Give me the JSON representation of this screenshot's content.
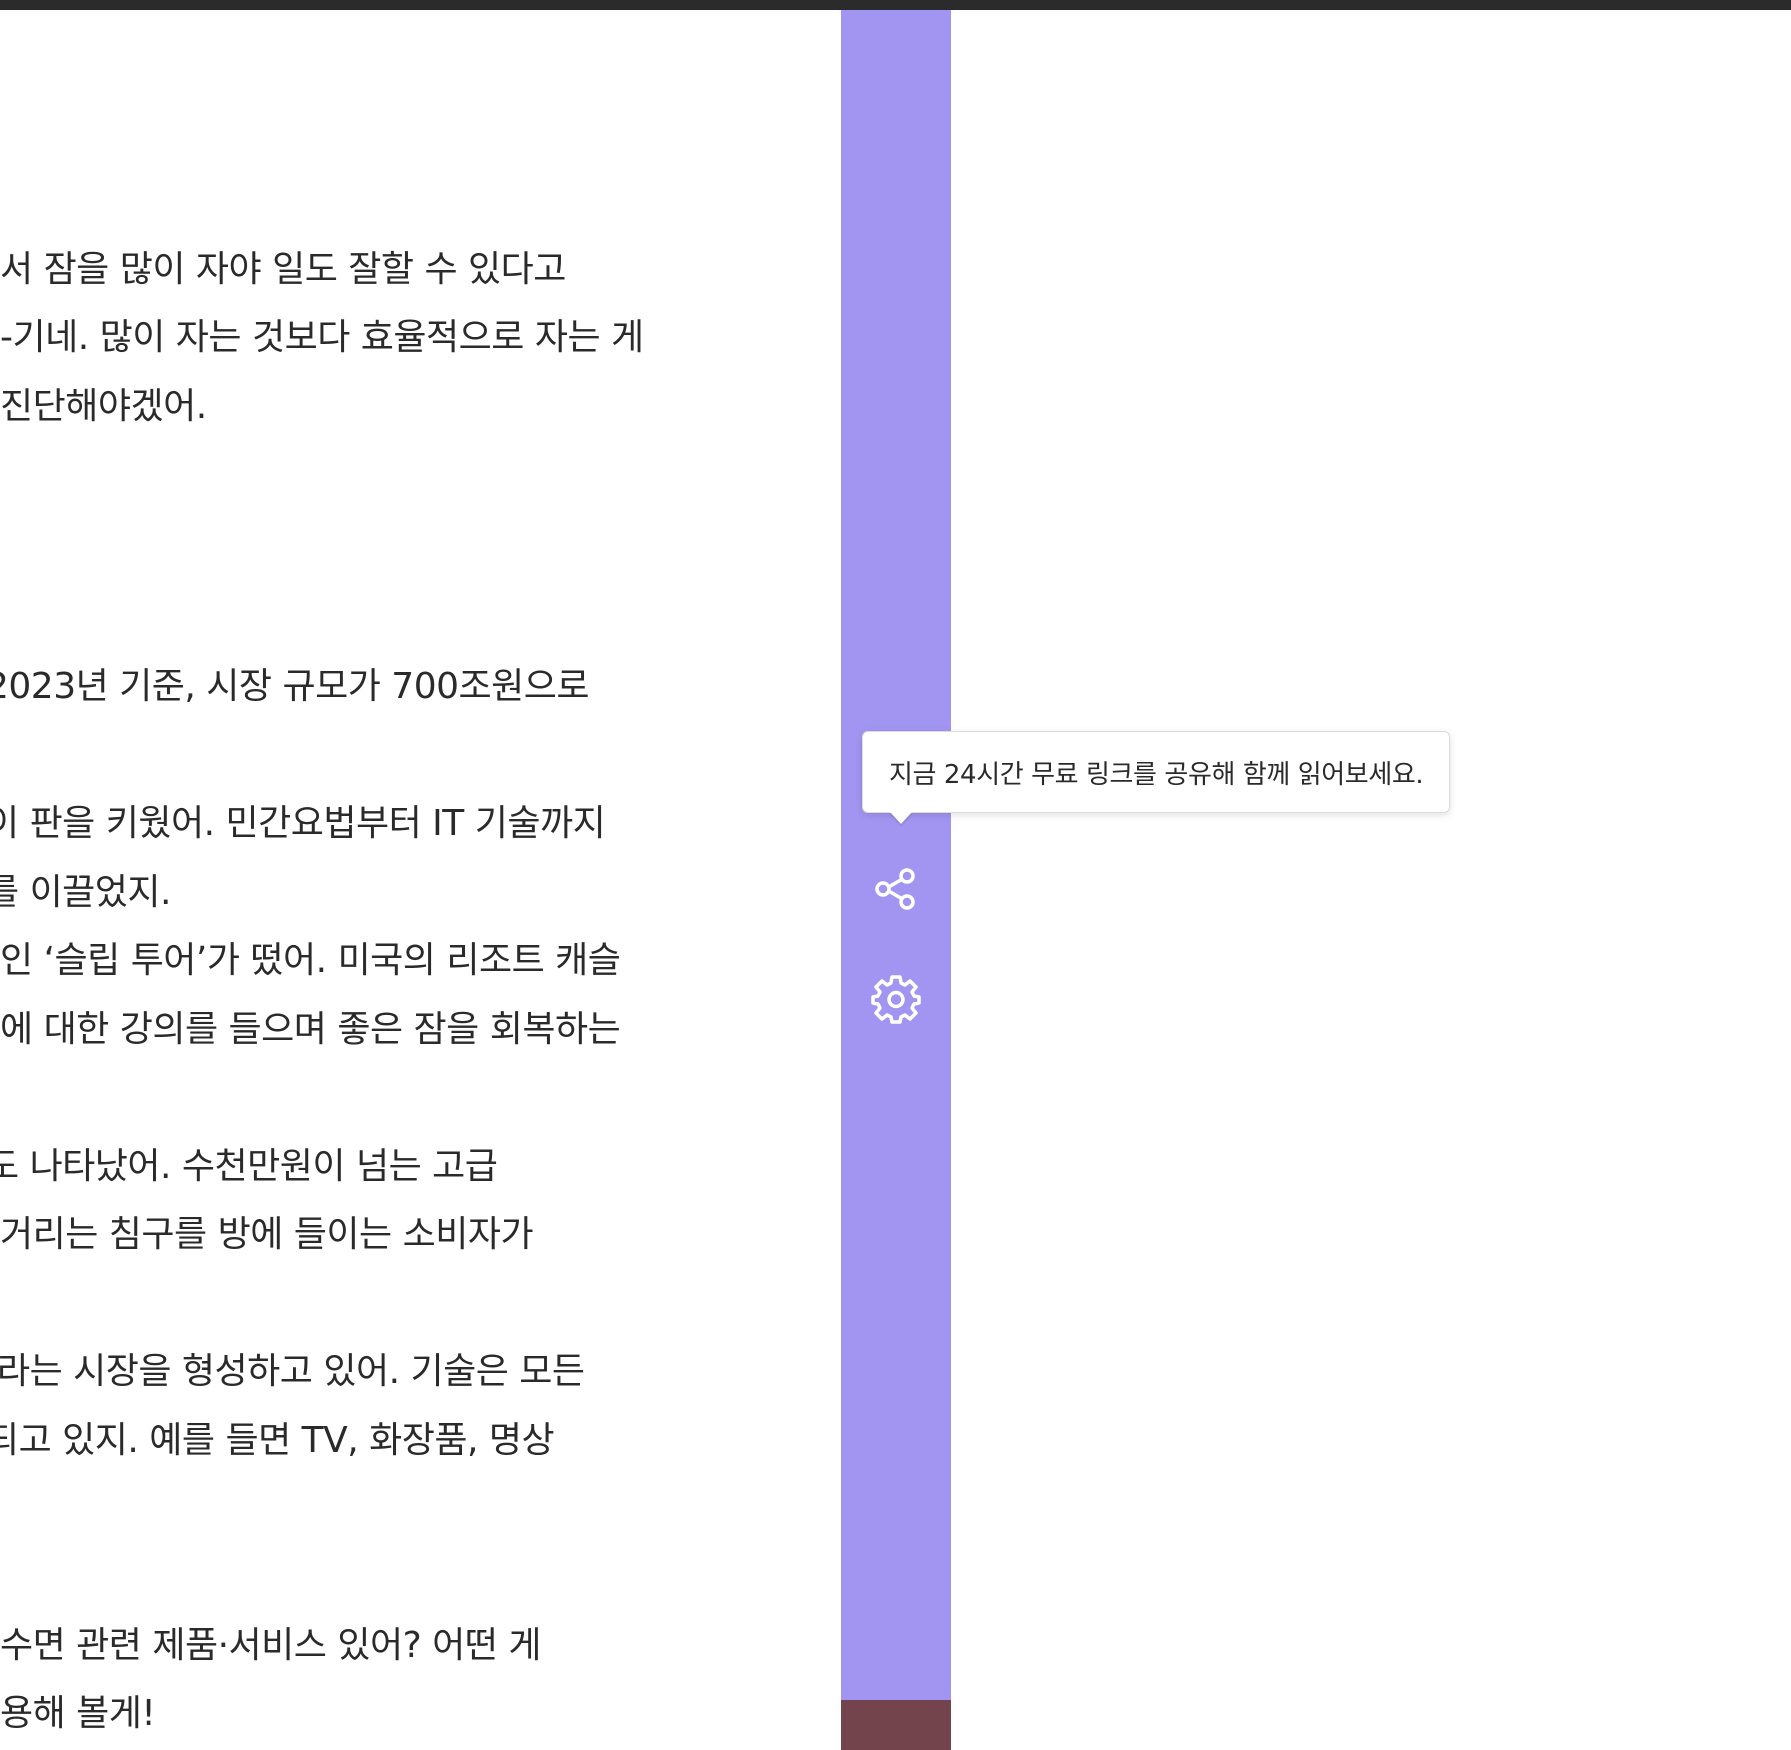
{
  "article": {
    "lines": [
      "서 잠을 많이 자야 일도 잘할 수 있다고",
      "-기네. 많이 자는 것보다 효율적으로 자는 게",
      " 진단해야겠어.",
      "2023년 기준, 시장 규모가 700조원으로",
      "이 판을 키웠어. 민간요법부터 IT 기술까지",
      "를 이끌었지.",
      "인 ‘슬립 투어’가 떴어. 미국의 리조트 캐슬",
      "에 대한 강의를 들으며 좋은 잠을 회복하는",
      "도 나타났어. 수천만원이 넘는 고급",
      "거리는 침구를 방에 들이는 소비자가",
      "’라는 시장을 형성하고 있어. 기술은 모든",
      "되고 있지. 예를 들면 TV, 화장품, 명상",
      " 수면 관련 제품·서비스 있어? 어떤 게",
      "용해 볼게!"
    ]
  },
  "sidebar": {
    "tooltip_text": "지금 24시간 무료 링크를 공유해 함께 읽어보세요.",
    "share_icon": "share-icon",
    "settings_icon": "gear-icon",
    "colors": {
      "rail": "#a295f1",
      "rail_bottom": "#73444c",
      "topbar": "#2b2b2b"
    }
  }
}
